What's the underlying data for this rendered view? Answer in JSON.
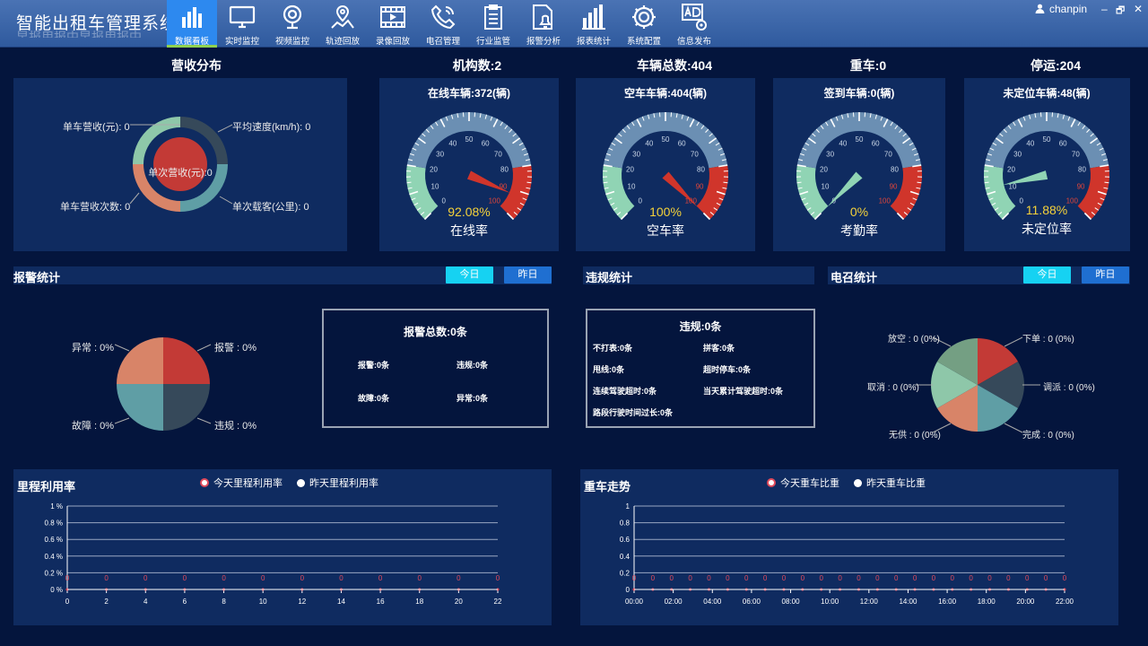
{
  "app": {
    "title": "智能出租车管理系统",
    "ghost": "早报用报中早报用报中"
  },
  "nav": [
    {
      "label": "数据看板",
      "icon": "bar-chart-icon",
      "active": true
    },
    {
      "label": "实时监控",
      "icon": "monitor-icon"
    },
    {
      "label": "视频监控",
      "icon": "camera-icon"
    },
    {
      "label": "轨迹回放",
      "icon": "map-route-icon"
    },
    {
      "label": "录像回放",
      "icon": "video-icon"
    },
    {
      "label": "电召管理",
      "icon": "phone-icon"
    },
    {
      "label": "行业监管",
      "icon": "clipboard-icon"
    },
    {
      "label": "报警分析",
      "icon": "alarm-bell-icon"
    },
    {
      "label": "报表统计",
      "icon": "report-chart-icon"
    },
    {
      "label": "系统配置",
      "icon": "gear-icon"
    },
    {
      "label": "信息发布",
      "icon": "ad-publish-icon"
    }
  ],
  "user": {
    "name": "chanpin",
    "win_min": "–",
    "win_restore": "🗗",
    "win_close": "✕"
  },
  "headings": {
    "revenue": "营收分布",
    "org": "机构数:2",
    "total": "车辆总数:404",
    "heavy": "重车:0",
    "stopped": "停运:204"
  },
  "revenue": {
    "center": "单次营收(元):0",
    "labels": [
      "单车营收(元): 0",
      "平均速度(km/h): 0",
      "单车营收次数: 0",
      "单次载客(公里): 0"
    ],
    "colors": [
      "#8ec7a9",
      "#36495a",
      "#d88468",
      "#5f9ea5"
    ],
    "center_color": "#c33a36"
  },
  "gauges": [
    {
      "title": "在线车辆:372(辆)",
      "percent_text": "92.08%",
      "name": "在线率",
      "value": 92.08
    },
    {
      "title": "空车车辆:404(辆)",
      "percent_text": "100%",
      "name": "空车率",
      "value": 100
    },
    {
      "title": "签到车辆:0(辆)",
      "percent_text": "0%",
      "name": "考勤率",
      "value": 0
    },
    {
      "title": "未定位车辆:48(辆)",
      "percent_text": "11.88%",
      "name": "未定位率",
      "value": 11.88
    }
  ],
  "gauge_ticks": [
    "0",
    "10",
    "20",
    "30",
    "40",
    "50",
    "60",
    "70",
    "80",
    "90",
    "100"
  ],
  "alarm": {
    "title": "报警统计",
    "today": "今日",
    "yesterday": "昨日",
    "labels": [
      "异常 : 0%",
      "报警 : 0%",
      "故障 : 0%",
      "违规 : 0%"
    ],
    "box_title": "报警总数:0条",
    "box_items": [
      "报警:0条",
      "违规:0条",
      "故障:0条",
      "异常:0条"
    ]
  },
  "violation": {
    "title": "违规统计",
    "box_title": "违规:0条",
    "items": [
      "不打表:0条",
      "拼客:0条",
      "甩线:0条",
      "超时停车:0条",
      "连续驾驶超时:0条",
      "当天累计驾驶超时:0条",
      "路段行驶时间过长:0条"
    ]
  },
  "dispatch": {
    "title": "电召统计",
    "today": "今日",
    "yesterday": "昨日",
    "labels": [
      "放空 : 0 (0%)",
      "下单 : 0 (0%)",
      "取消 : 0 (0%)",
      "调派 : 0 (0%)",
      "无供 : 0 (0%)",
      "完成 : 0 (0%)"
    ],
    "colors": [
      "#c33a36",
      "#36495a",
      "#5f9ea5",
      "#d88468",
      "#8ec7a9",
      "#749f83"
    ]
  },
  "colors": {
    "bg": "#04153d",
    "panel": "#0f2b60",
    "accent": "#2d89ef",
    "danger": "#d0352b",
    "highlight": "#f5d23a"
  },
  "chart_data": [
    {
      "type": "line",
      "title": "里程利用率",
      "categories": [
        "0",
        "2",
        "4",
        "6",
        "8",
        "10",
        "12",
        "14",
        "16",
        "18",
        "20",
        "22"
      ],
      "series": [
        {
          "name": "今天里程利用率",
          "values": [
            0,
            0,
            0,
            0,
            0,
            0,
            0,
            0,
            0,
            0,
            0,
            0
          ]
        },
        {
          "name": "昨天里程利用率",
          "values": [
            0,
            0,
            0,
            0,
            0,
            0,
            0,
            0,
            0,
            0,
            0,
            0
          ]
        }
      ],
      "ylim": [
        0,
        1
      ],
      "yticks": [
        "0 %",
        "0.2 %",
        "0.4 %",
        "0.6 %",
        "0.8 %",
        "1 %"
      ],
      "grid": true,
      "legend": "top-center"
    },
    {
      "type": "line",
      "title": "重车走势",
      "categories": [
        "00:00",
        "02:00",
        "04:00",
        "06:00",
        "08:00",
        "10:00",
        "12:00",
        "14:00",
        "16:00",
        "18:00",
        "20:00",
        "22:00"
      ],
      "series": [
        {
          "name": "今天重车比重",
          "values": [
            0,
            0,
            0,
            0,
            0,
            0,
            0,
            0,
            0,
            0,
            0,
            0,
            0,
            0,
            0,
            0,
            0,
            0,
            0,
            0,
            0,
            0,
            0,
            0
          ]
        },
        {
          "name": "昨天重车比重",
          "values": [
            0,
            0,
            0,
            0,
            0,
            0,
            0,
            0,
            0,
            0,
            0,
            0,
            0,
            0,
            0,
            0,
            0,
            0,
            0,
            0,
            0,
            0,
            0,
            0
          ]
        }
      ],
      "ylim": [
        0,
        1
      ],
      "yticks": [
        "0",
        "0.2",
        "0.4",
        "0.6",
        "0.8",
        "1"
      ],
      "grid": true,
      "legend": "top-center"
    }
  ]
}
